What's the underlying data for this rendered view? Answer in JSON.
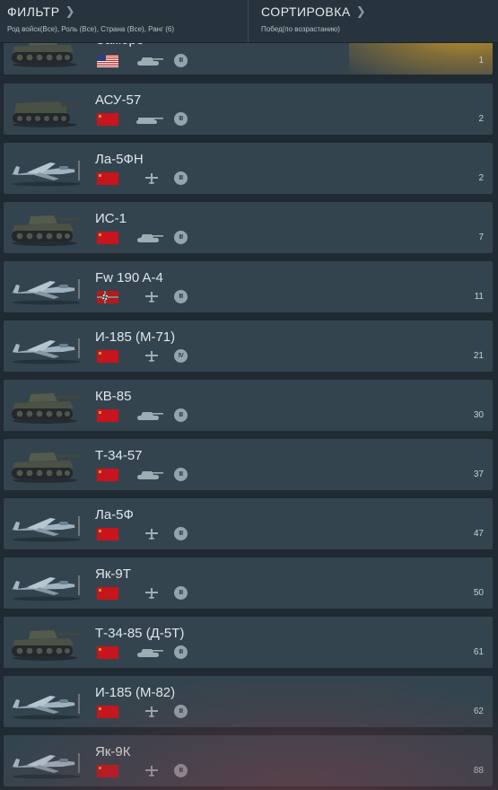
{
  "header": {
    "filter_title": "ФИЛЬТР",
    "filter_sub": "Род войск(Все), Роль (Все), Страна (Все), Ранг (6)",
    "sort_title": "СОРТИРОВКА",
    "sort_sub": "Побед(по возрастанию)"
  },
  "vehicles": [
    {
      "name": "Calliope",
      "nation": "usa",
      "type": "tank",
      "rank": "III",
      "count": "1"
    },
    {
      "name": "АСУ-57",
      "nation": "ussr",
      "type": "spg",
      "rank": "III",
      "count": "2"
    },
    {
      "name": "Ла-5ФН",
      "nation": "ussr",
      "type": "plane",
      "rank": "III",
      "count": "2"
    },
    {
      "name": "ИС-1",
      "nation": "ussr",
      "type": "tank",
      "rank": "III",
      "count": "7"
    },
    {
      "name": "Fw 190 A-4",
      "nation": "germany",
      "type": "plane",
      "rank": "III",
      "count": "11"
    },
    {
      "name": "И-185 (М-71)",
      "nation": "ussr",
      "type": "plane",
      "rank": "IV",
      "count": "21"
    },
    {
      "name": "КВ-85",
      "nation": "ussr",
      "type": "tank",
      "rank": "III",
      "count": "30"
    },
    {
      "name": "Т-34-57",
      "nation": "ussr",
      "type": "tank",
      "rank": "III",
      "count": "37"
    },
    {
      "name": "Ла-5Ф",
      "nation": "ussr",
      "type": "plane",
      "rank": "III",
      "count": "47"
    },
    {
      "name": "Як-9Т",
      "nation": "ussr",
      "type": "plane",
      "rank": "III",
      "count": "50"
    },
    {
      "name": "Т-34-85 (Д-5Т)",
      "nation": "ussr",
      "type": "tank",
      "rank": "III",
      "count": "61"
    },
    {
      "name": "И-185 (М-82)",
      "nation": "ussr",
      "type": "plane",
      "rank": "III",
      "count": "62"
    },
    {
      "name": "Як-9К",
      "nation": "ussr",
      "type": "plane",
      "rank": "III",
      "count": "88"
    }
  ],
  "colors": {
    "background": "#1f2a32",
    "card": "#34444e",
    "header": "#27343d",
    "ussr_red": "#c8141c",
    "highlight_gold": "#d4a028"
  }
}
